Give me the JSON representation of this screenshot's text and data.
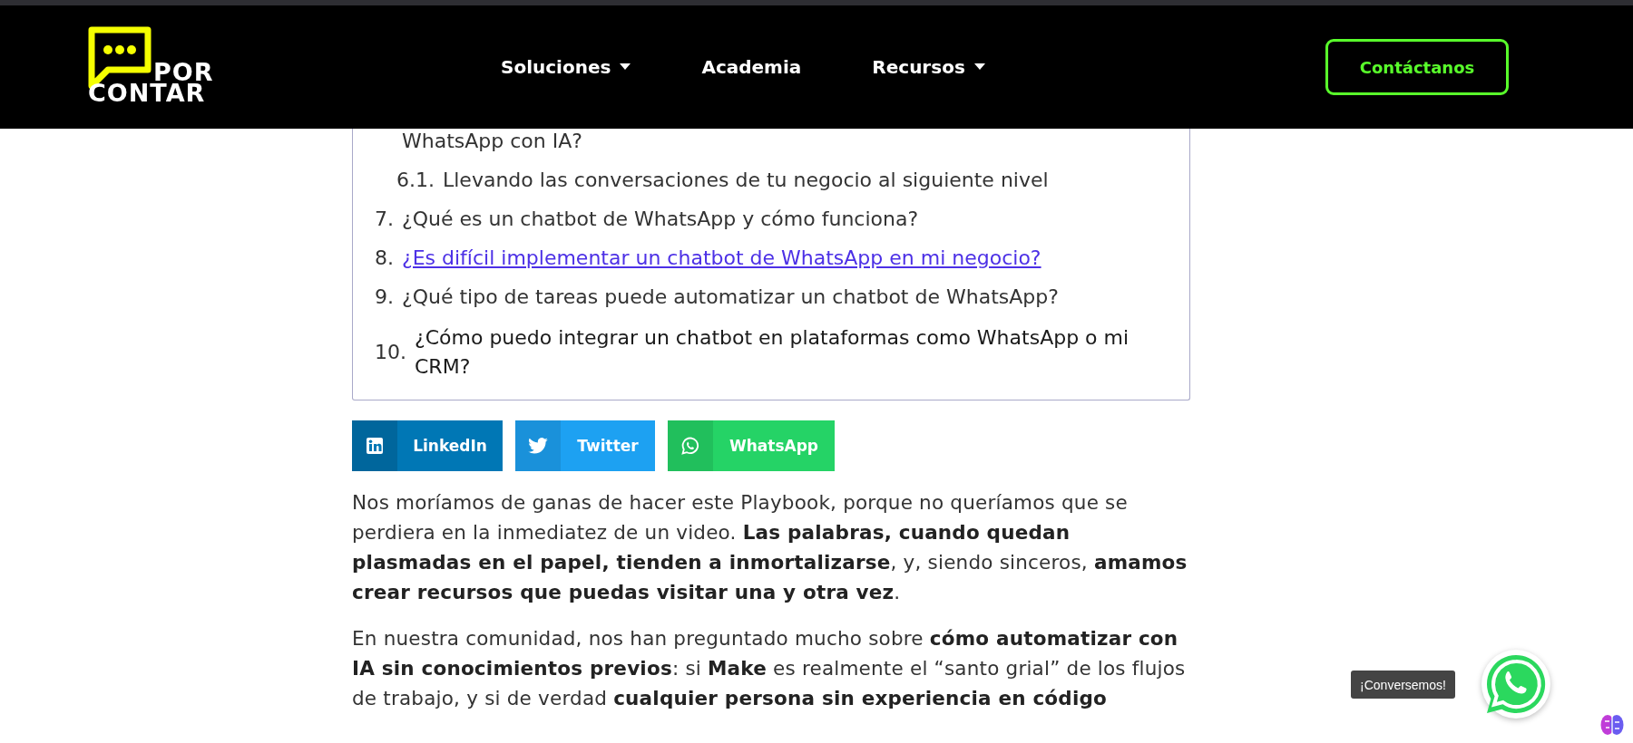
{
  "header": {
    "logo": {
      "line1": "POR",
      "line2": "CONTAR"
    },
    "nav": [
      {
        "label": "Soluciones",
        "dropdown": true
      },
      {
        "label": "Academia",
        "dropdown": false
      },
      {
        "label": "Recursos",
        "dropdown": true
      }
    ],
    "cta": "Contáctanos"
  },
  "toc": [
    {
      "kind": "continuation",
      "text": "WhatsApp con IA?",
      "highlighted": false
    },
    {
      "kind": "sub",
      "number": "6.1.",
      "text": "Llevando las conversaciones de tu negocio al siguiente nivel",
      "highlighted": false
    },
    {
      "kind": "item",
      "number": "7.",
      "text": "¿Qué es un chatbot de WhatsApp y cómo funciona?",
      "highlighted": false
    },
    {
      "kind": "item",
      "number": "8.",
      "text": "¿Es difícil implementar un chatbot de WhatsApp en mi negocio?",
      "highlighted": true
    },
    {
      "kind": "item",
      "number": "9.",
      "text": "¿Qué tipo de tareas puede automatizar un chatbot de WhatsApp?",
      "highlighted": false
    },
    {
      "kind": "item",
      "number": "10.",
      "text": "¿Cómo puedo integrar un chatbot en plataformas como WhatsApp o mi CRM?",
      "highlighted": false
    }
  ],
  "share": [
    {
      "kind": "linkedin",
      "label": "LinkedIn"
    },
    {
      "kind": "twitter",
      "label": "Twitter"
    },
    {
      "kind": "whatsapp",
      "label": "WhatsApp"
    }
  ],
  "paragraphs": [
    "Nos moríamos de ganas de hacer este Playbook, porque no queríamos que se perdiera en la inmediatez de un video. **Las palabras, cuando quedan plasmadas en el papel, tienden a inmortalizarse**, y, siendo sinceros, **amamos crear recursos que puedas visitar una y otra vez**.",
    "En nuestra comunidad, nos han preguntado mucho sobre **cómo automatizar con IA sin conocimientos previos**: si **Make** es realmente el “santo grial” de los flujos de trabajo, y si de verdad **cualquier persona sin experiencia en código**"
  ],
  "chat": {
    "tooltip": "¡Conversemos!"
  }
}
